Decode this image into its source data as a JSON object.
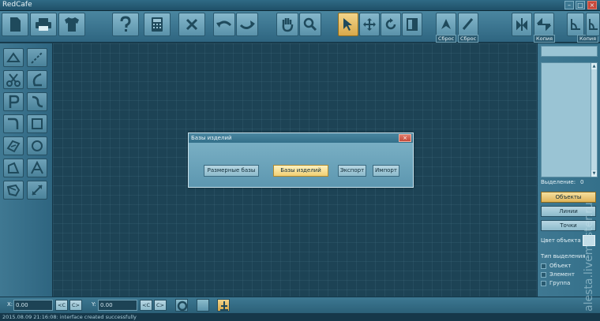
{
  "app": {
    "title": "RedCafe"
  },
  "window_controls": {
    "minimize": "–",
    "maximize": "□",
    "close": "×"
  },
  "toolbar": {
    "labels": {
      "reset_1": "Сброс",
      "reset_2": "Сброс",
      "copy_1": "Копия",
      "copy_2": "Копия"
    },
    "icons": [
      "new-document-icon",
      "print-icon",
      "shirt-icon",
      "help-icon",
      "calculator-icon",
      "cross-icon",
      "undo-icon",
      "redo-icon",
      "hand-icon",
      "zoom-icon",
      "pointer-icon",
      "move-icon",
      "rotate-icon",
      "mirror-icon",
      "shape-icon",
      "pencil-icon",
      "flip-vertical-icon",
      "flip-horizontal-icon",
      "angle-icon",
      "angle-copy-icon"
    ]
  },
  "left_tools": [
    "triangle-icon",
    "scissors-icon",
    "letter-p-icon",
    "corner-icon",
    "quadrilateral-icon",
    "pentagon-icon",
    "rotated-shape-icon",
    "dashed-line-icon",
    "curve-icon",
    "s-curve-icon",
    "square-icon",
    "circle-icon",
    "letter-a-icon",
    "resize-arrow-icon"
  ],
  "dialog": {
    "title": "Базы изделий",
    "close": "×",
    "buttons": {
      "size_bases": "Размерные базы",
      "product_bases": "Базы изделий",
      "export": "Экспорт",
      "import": "Импорт"
    }
  },
  "right_panel": {
    "selection_label": "Выделение:",
    "selection_count": "0",
    "buttons": {
      "objects": "Объекты",
      "lines": "Линии",
      "points": "Точки"
    },
    "object_color_label": "Цвет объекта",
    "selection_type_label": "Тип выделения :",
    "options": {
      "object": "Объект",
      "element": "Элемент",
      "group": "Группа"
    },
    "scroll_up": "▲",
    "scroll_down": "▼"
  },
  "statusbar": {
    "x_label": "X:",
    "x_value": "0.00",
    "y_label": "Y:",
    "y_value": "0.00",
    "prev": "<C",
    "next": "C>"
  },
  "log": {
    "text": "2015.08.09 21:16:08: interface created successfully"
  },
  "watermark": {
    "text": "alesta.livemaster.ru"
  }
}
